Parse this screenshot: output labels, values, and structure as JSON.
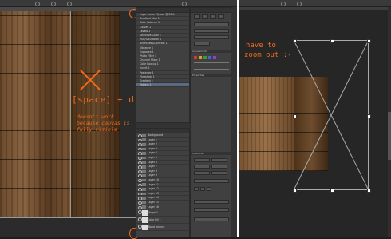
{
  "annotations": {
    "main": "[space] + drag",
    "note_lines": [
      "doesn't work",
      "because canvas is",
      "fully visible"
    ],
    "right_note_line1": "have to",
    "right_note_line2": "zoom out :-"
  },
  "top_panel_rows": [
    "Layer name (1).psd @ 50%",
    "Gradient Map 1",
    "Color Balance 1",
    "Curves 1",
    "Levels 1",
    "Selective Color 1",
    "Hue/Saturation 1",
    "Brightness/Contrast 1",
    "Vibrance 1",
    "Exposure 1",
    "Photo Filter 1",
    "Channel Mixer 1",
    "Color Lookup 1",
    "Invert 1",
    "Posterize 1",
    "Threshold 1",
    "Gradient 1",
    "Pattern 1"
  ],
  "layer_rows": [
    "Background",
    "Layer 1",
    "Layer 2",
    "Layer 3",
    "Layer 4",
    "Layer 5",
    "Layer 6",
    "Layer 7",
    "Layer 8",
    "Layer 9",
    "Layer 10",
    "Layer 11",
    "Layer 12",
    "Layer 13",
    "Layer 14",
    "Layer 15",
    "Layer 16"
  ],
  "big_layers": [
    "Shape 1",
    "Color Fill 1",
    "Wood texture"
  ],
  "side_panel": {
    "adjustments_title": "Adjustments",
    "properties_title": "Properties",
    "character_title": "Character"
  },
  "colors": {
    "accent": "#f06a1a",
    "selection": "#5a6a85",
    "panel": "#404040"
  }
}
